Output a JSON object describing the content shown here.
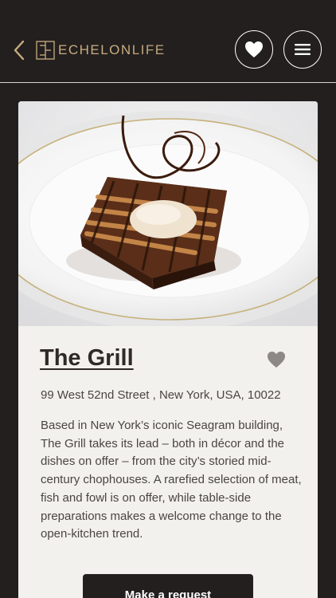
{
  "header": {
    "brand_primary": "ECHELON",
    "brand_secondary": "LIFE",
    "back_icon": "chevron-left-icon",
    "favorites_icon": "heart-icon",
    "menu_icon": "hamburger-menu-icon"
  },
  "venue": {
    "name": "The Grill",
    "address": "99 West 52nd Street , New York, USA, 10022",
    "description": "Based in New York’s iconic Seagram building, The Grill takes its lead – both in décor and the dishes on offer – from the city’s storied mid-century chophouses. A rarefied selection of meat, fish and fowl is on offer, while table-side preparations makes a welcome change to the open-kitchen trend.",
    "favorite_icon": "heart-icon"
  },
  "actions": {
    "request_label": "Make a request"
  },
  "colors": {
    "background": "#231f1f",
    "accent_gold": "#c8ad7f",
    "card": "#f2f1ee",
    "text": "#4a4542"
  }
}
